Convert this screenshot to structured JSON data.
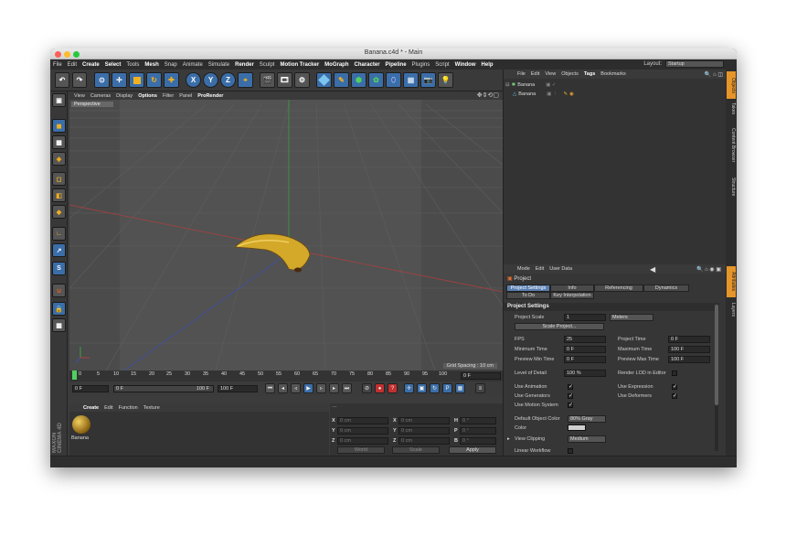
{
  "window": {
    "title": "Banana.c4d * - Main"
  },
  "menubar": {
    "items": [
      "File",
      "Edit",
      "Create",
      "Select",
      "Tools",
      "Mesh",
      "Snap",
      "Animate",
      "Simulate",
      "Render",
      "Sculpt",
      "Motion Tracker",
      "MoGraph",
      "Character",
      "Pipeline",
      "Plugins",
      "Script",
      "Window",
      "Help"
    ],
    "layout_label": "Layout:",
    "layout_value": "Startup"
  },
  "viewport": {
    "menu": [
      "View",
      "Cameras",
      "Display",
      "Options",
      "Filter",
      "Panel",
      "ProRender"
    ],
    "label": "Perspective",
    "grid_spacing": "Grid Spacing : 10 cm"
  },
  "timeline": {
    "ticks": [
      "0",
      "5",
      "10",
      "15",
      "20",
      "25",
      "30",
      "35",
      "40",
      "45",
      "50",
      "55",
      "60",
      "65",
      "70",
      "75",
      "80",
      "85",
      "90",
      "95",
      "100"
    ],
    "current": "0 F",
    "start": "0 F",
    "preview_start": "0 F",
    "preview_end": "100 F",
    "end": "100 F"
  },
  "material_panel": {
    "menu": [
      "Create",
      "Edit",
      "Function",
      "Texture"
    ],
    "material_name": "Banana",
    "brand": "MAXON CINEMA 4D"
  },
  "coordinates": {
    "header": "---",
    "rows": [
      {
        "a": "X",
        "av": "0 cm",
        "b": "X",
        "bv": "0 cm",
        "c": "H",
        "cv": "0 °"
      },
      {
        "a": "Y",
        "av": "0 cm",
        "b": "Y",
        "bv": "0 cm",
        "c": "P",
        "cv": "0 °"
      },
      {
        "a": "Z",
        "av": "0 cm",
        "b": "Z",
        "bv": "0 cm",
        "c": "B",
        "cv": "0 °"
      }
    ],
    "mode": "World",
    "scale": "Scale",
    "apply": "Apply"
  },
  "objects_panel": {
    "menu": [
      "File",
      "Edit",
      "View",
      "Objects",
      "Tags",
      "Bookmarks"
    ],
    "items": [
      "Banana",
      "Banana"
    ]
  },
  "attributes": {
    "menu": [
      "Mode",
      "Edit",
      "User Data"
    ],
    "object": "Project",
    "tabs": [
      "Project Settings",
      "Info",
      "Referencing",
      "Dynamics",
      "To Do",
      "Key Interpolation"
    ],
    "section": "Project Settings",
    "project_scale_label": "Project Scale",
    "project_scale_value": "1",
    "project_scale_unit": "Meters",
    "scale_project_button": "Scale Project...",
    "fps_label": "FPS",
    "fps": "25",
    "project_time_label": "Project Time",
    "project_time": "0 F",
    "min_time_label": "Minimum Time",
    "min_time": "0 F",
    "max_time_label": "Maximum Time",
    "max_time": "100 F",
    "prev_min_label": "Preview Min Time",
    "prev_min": "0 F",
    "prev_max_label": "Preview Max Time",
    "prev_max": "100 F",
    "lod_label": "Level of Detail",
    "lod": "100 %",
    "render_lod_label": "Render LOD in Editor",
    "use_animation": "Use Animation",
    "use_expression": "Use Expression",
    "use_generators": "Use Generators",
    "use_deformers": "Use Deformers",
    "use_motion": "Use Motion System",
    "default_color_label": "Default Object Color",
    "default_color": "80% Gray",
    "color_label": "Color",
    "view_clipping_label": "View Clipping",
    "view_clipping": "Medium",
    "linear_workflow_label": "Linear Workflow",
    "input_color_label": "Input Color Profile",
    "input_color": "Disabled"
  },
  "right_tabs": [
    "Objects",
    "Takes",
    "Content Browser",
    "Structure",
    "Attributes",
    "Layers"
  ],
  "icons": [
    "undo-icon",
    "redo-icon",
    "live-select-icon",
    "move-icon",
    "scale-icon",
    "rotate-icon",
    "cursor-icon",
    "x-axis-icon",
    "y-axis-icon",
    "z-axis-icon",
    "coordinate-system-icon",
    "render-view-icon",
    "render-picture-viewer-icon",
    "edit-render-settings-icon",
    "cube-icon",
    "pen-icon",
    "subdivision-icon",
    "array-icon",
    "deformer-icon",
    "floor-icon",
    "camera-icon",
    "light-icon"
  ],
  "colors": {
    "accent": "#5a7fb2",
    "banana": "#d4a829",
    "bg": "#3c3c3c"
  }
}
